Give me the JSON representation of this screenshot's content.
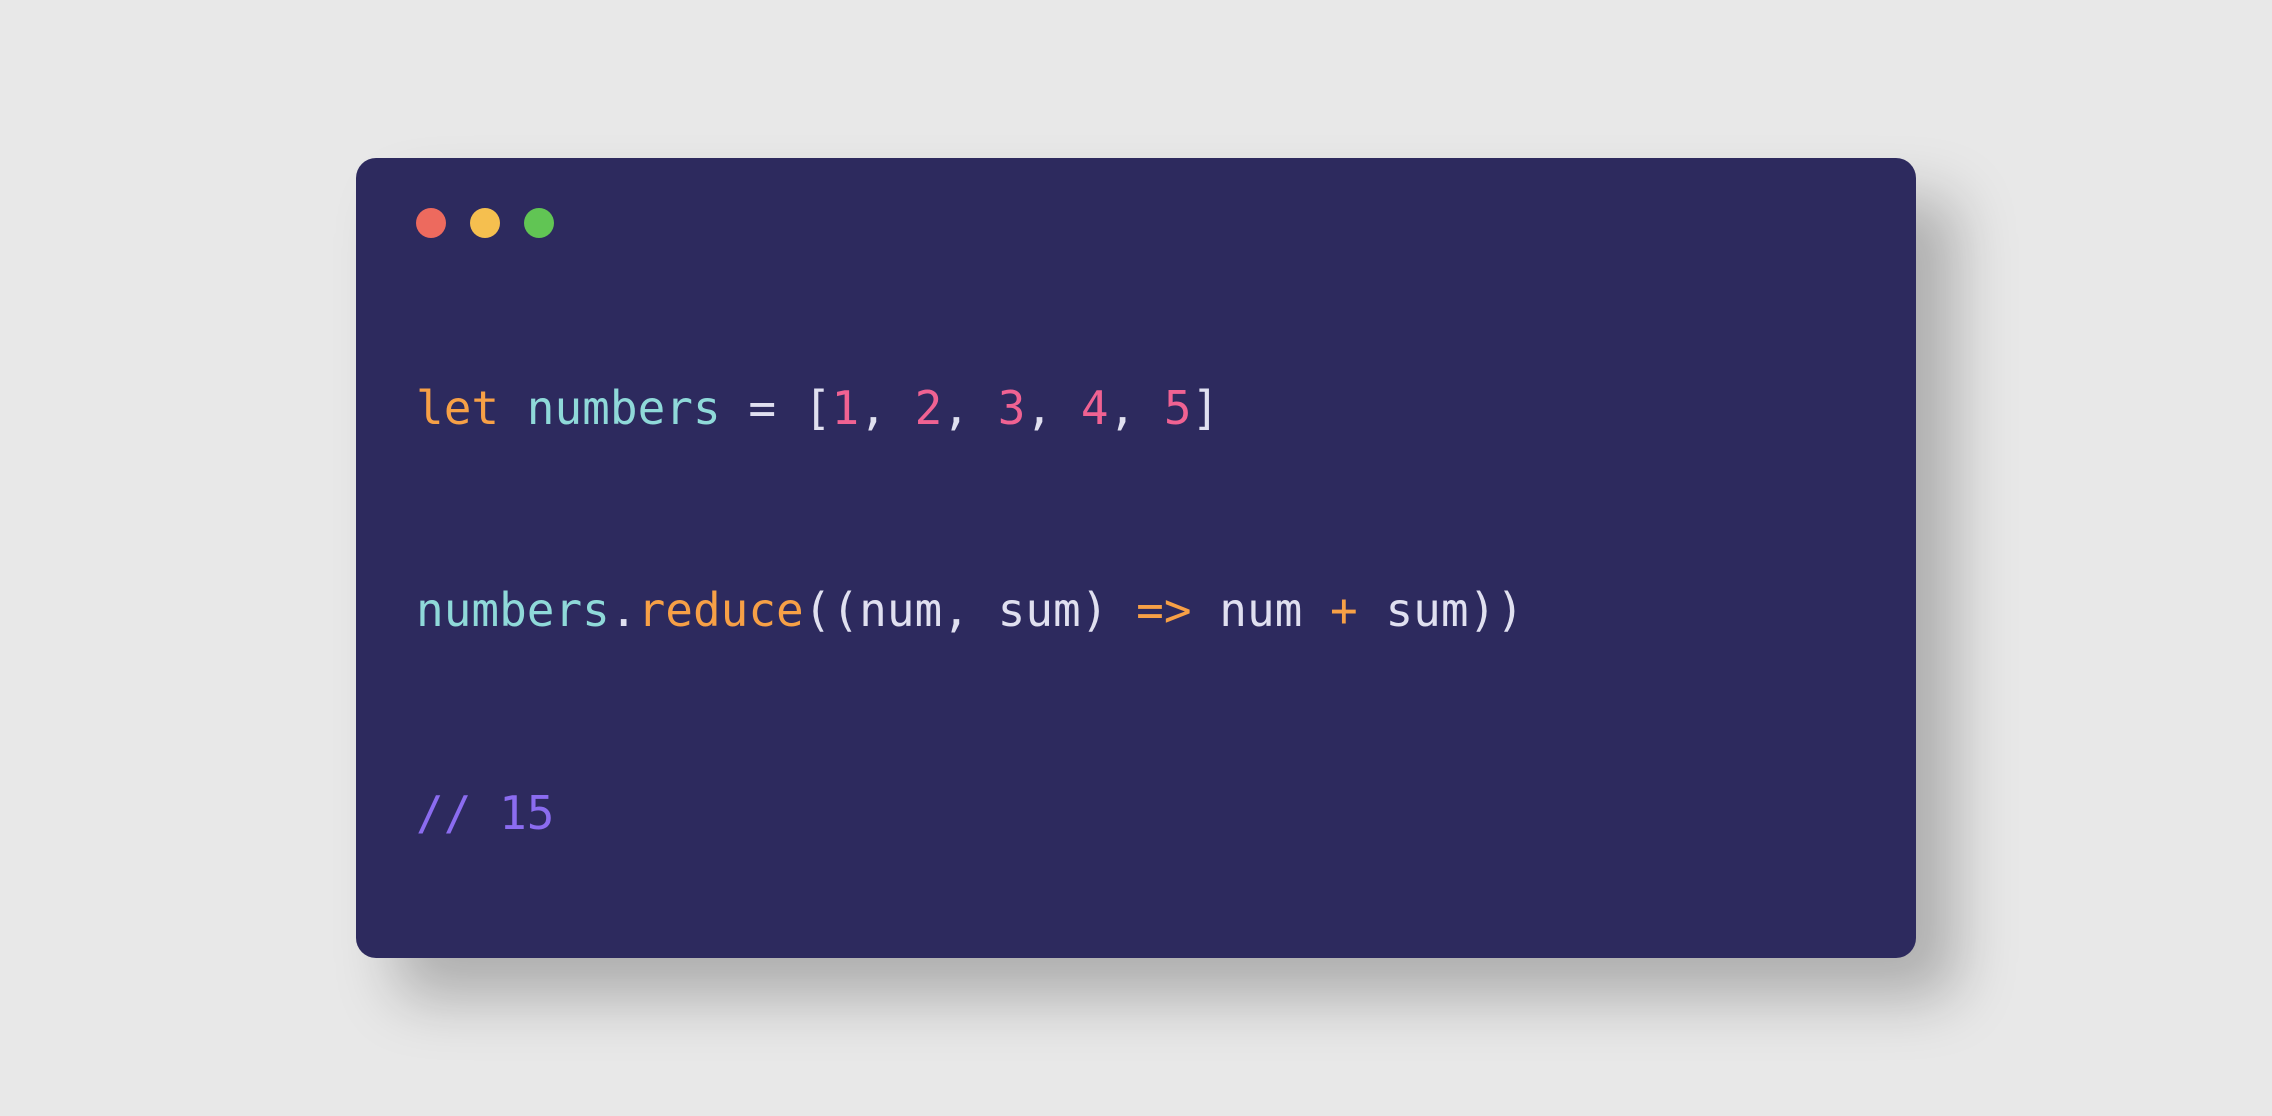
{
  "colors": {
    "background": "#e8e8e8",
    "editor_bg": "#2d2a5e",
    "traffic_red": "#ed6a5e",
    "traffic_yellow": "#f5bf4f",
    "traffic_green": "#61c554",
    "keyword": "#f7a046",
    "variable": "#8fd9d9",
    "operator": "#e0e0f0",
    "number": "#f06292",
    "method": "#f7a046",
    "arrow": "#f7a046",
    "comment": "#8b6cf0"
  },
  "code": {
    "line1": {
      "keyword": "let",
      "space1": " ",
      "var1": "numbers",
      "space2": " ",
      "equals": "=",
      "space3": " ",
      "lbracket": "[",
      "n1": "1",
      "c1": ",",
      "s1": " ",
      "n2": "2",
      "c2": ",",
      "s2": " ",
      "n3": "3",
      "c3": ",",
      "s3": " ",
      "n4": "4",
      "c4": ",",
      "s4": " ",
      "n5": "5",
      "rbracket": "]"
    },
    "line2": "",
    "line3": {
      "var1": "numbers",
      "dot": ".",
      "method": "reduce",
      "lp1": "(",
      "lp2": "(",
      "param1": "num",
      "c1": ",",
      "s1": " ",
      "param2": "sum",
      "rp1": ")",
      "s2": " ",
      "arrow": "=>",
      "s3": " ",
      "arg1": "num",
      "s4": " ",
      "plus": "+",
      "s5": " ",
      "arg2": "sum",
      "rp2": ")",
      "rp3": ")"
    },
    "line4": "",
    "line5": {
      "comment": "// 15"
    }
  }
}
